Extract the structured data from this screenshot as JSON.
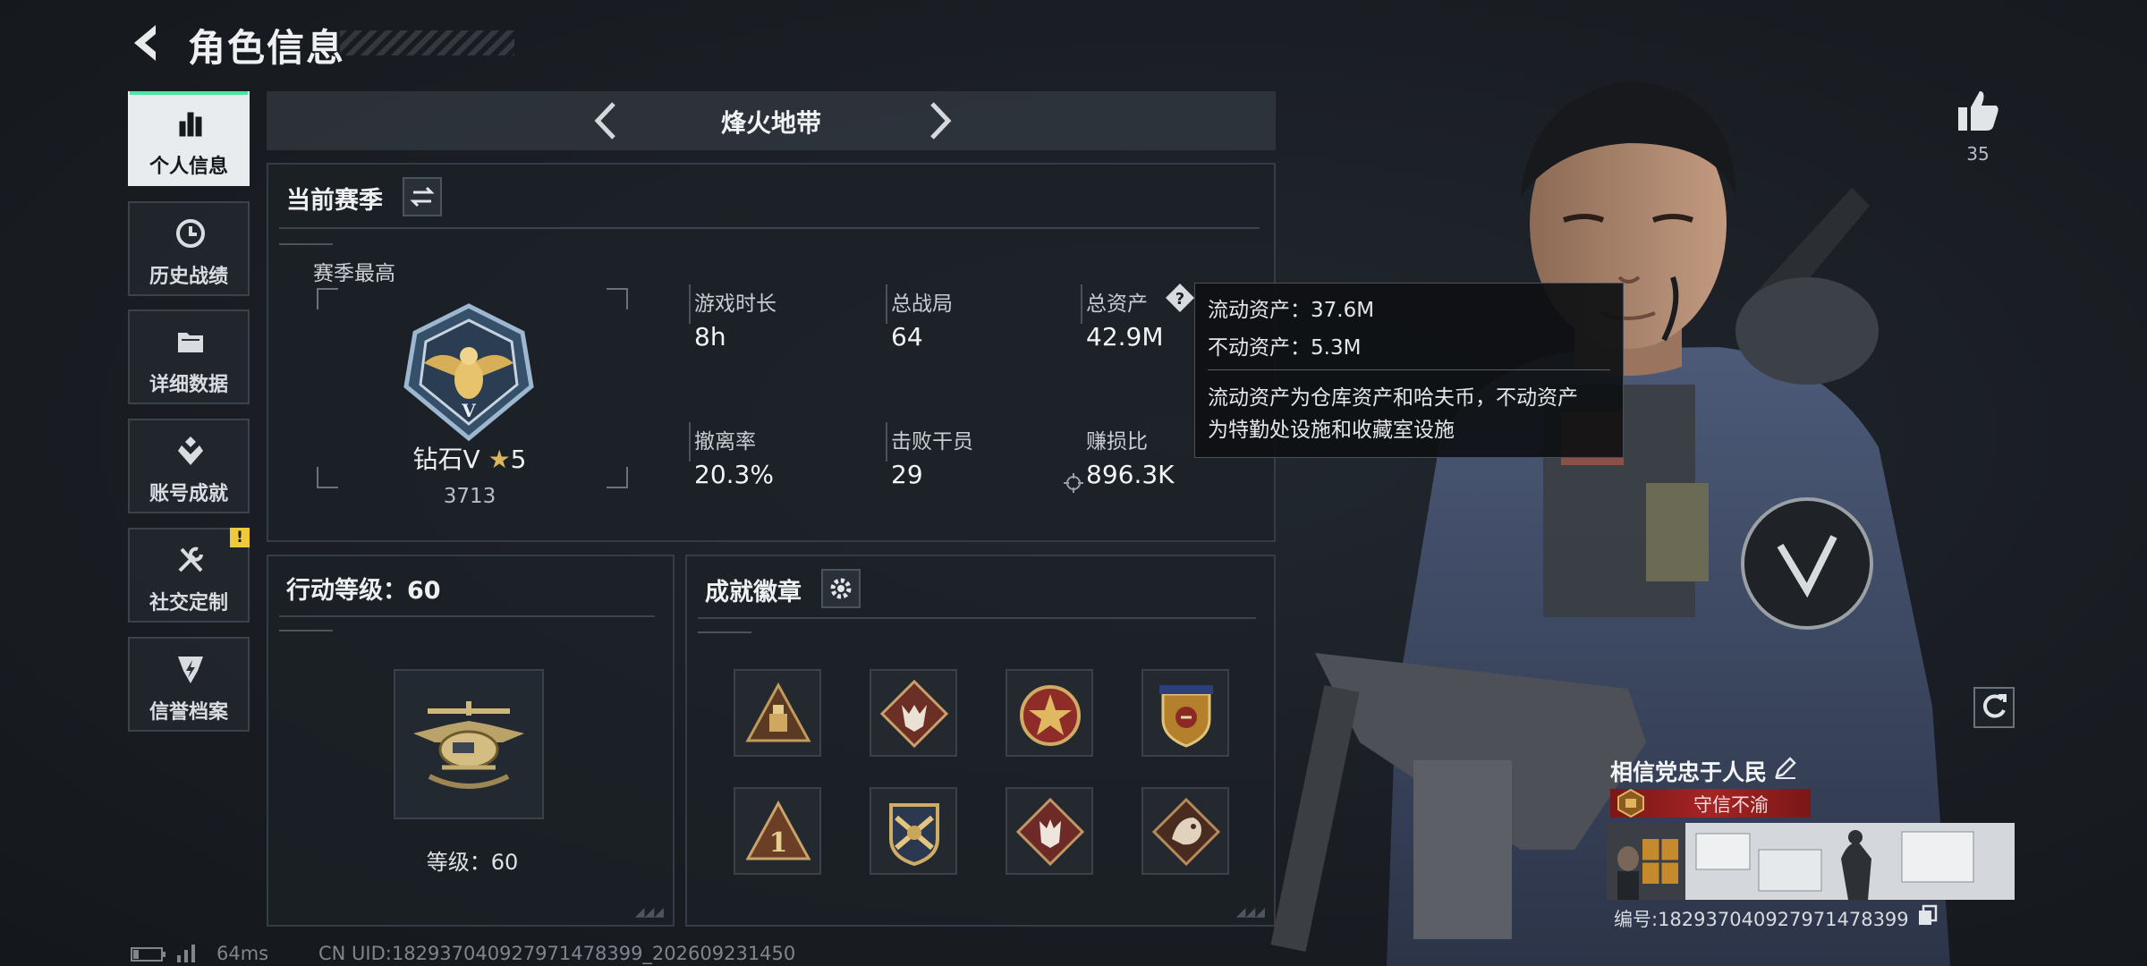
{
  "header": {
    "title": "角色信息"
  },
  "sidebar": {
    "items": [
      {
        "label": "个人信息",
        "icon": "bar-chart-icon",
        "active": true
      },
      {
        "label": "历史战绩",
        "icon": "history-clock-icon"
      },
      {
        "label": "详细数据",
        "icon": "folder-icon"
      },
      {
        "label": "账号成就",
        "icon": "achievement-icon"
      },
      {
        "label": "社交定制",
        "icon": "wrench-icon",
        "badge": "!"
      },
      {
        "label": "信誉档案",
        "icon": "credit-shield-icon"
      }
    ]
  },
  "mode": {
    "name": "烽火地带"
  },
  "season": {
    "title": "当前赛季",
    "best_label": "赛季最高",
    "rank_name": "钻石V",
    "rank_stars": "5",
    "rank_points": "3713"
  },
  "stats": [
    {
      "label": "游戏时长",
      "value": "8h"
    },
    {
      "label": "总战局",
      "value": "64"
    },
    {
      "label": "总资产",
      "value": "42.9M"
    },
    {
      "label": "撤离率",
      "value": "20.3%"
    },
    {
      "label": "击败干员",
      "value": "29"
    },
    {
      "label": "赚损比",
      "value": "896.3K"
    }
  ],
  "tooltip": {
    "liquid": "流动资产：37.6M",
    "fixed": "不动资产：5.3M",
    "desc_line1": "流动资产为仓库资产和哈夫币，不动资产",
    "desc_line2": "为特勤处设施和收藏室设施"
  },
  "action_level": {
    "title": "行动等级：60",
    "level_text": "等级：60"
  },
  "achievements": {
    "title": "成就徽章",
    "badge_count": 8
  },
  "likes": {
    "count": "35"
  },
  "profile": {
    "nickname": "相信党忠于人民",
    "title_badge": "守信不渝",
    "serial": "编号:1829370409279714783​99"
  },
  "footer": {
    "ping": "64ms",
    "uid": "CN UID:1829370409279714783​99_202609231450"
  },
  "colors": {
    "accent": "#48e6a0",
    "warning": "#f0c93a",
    "title_red": "#a52424"
  }
}
